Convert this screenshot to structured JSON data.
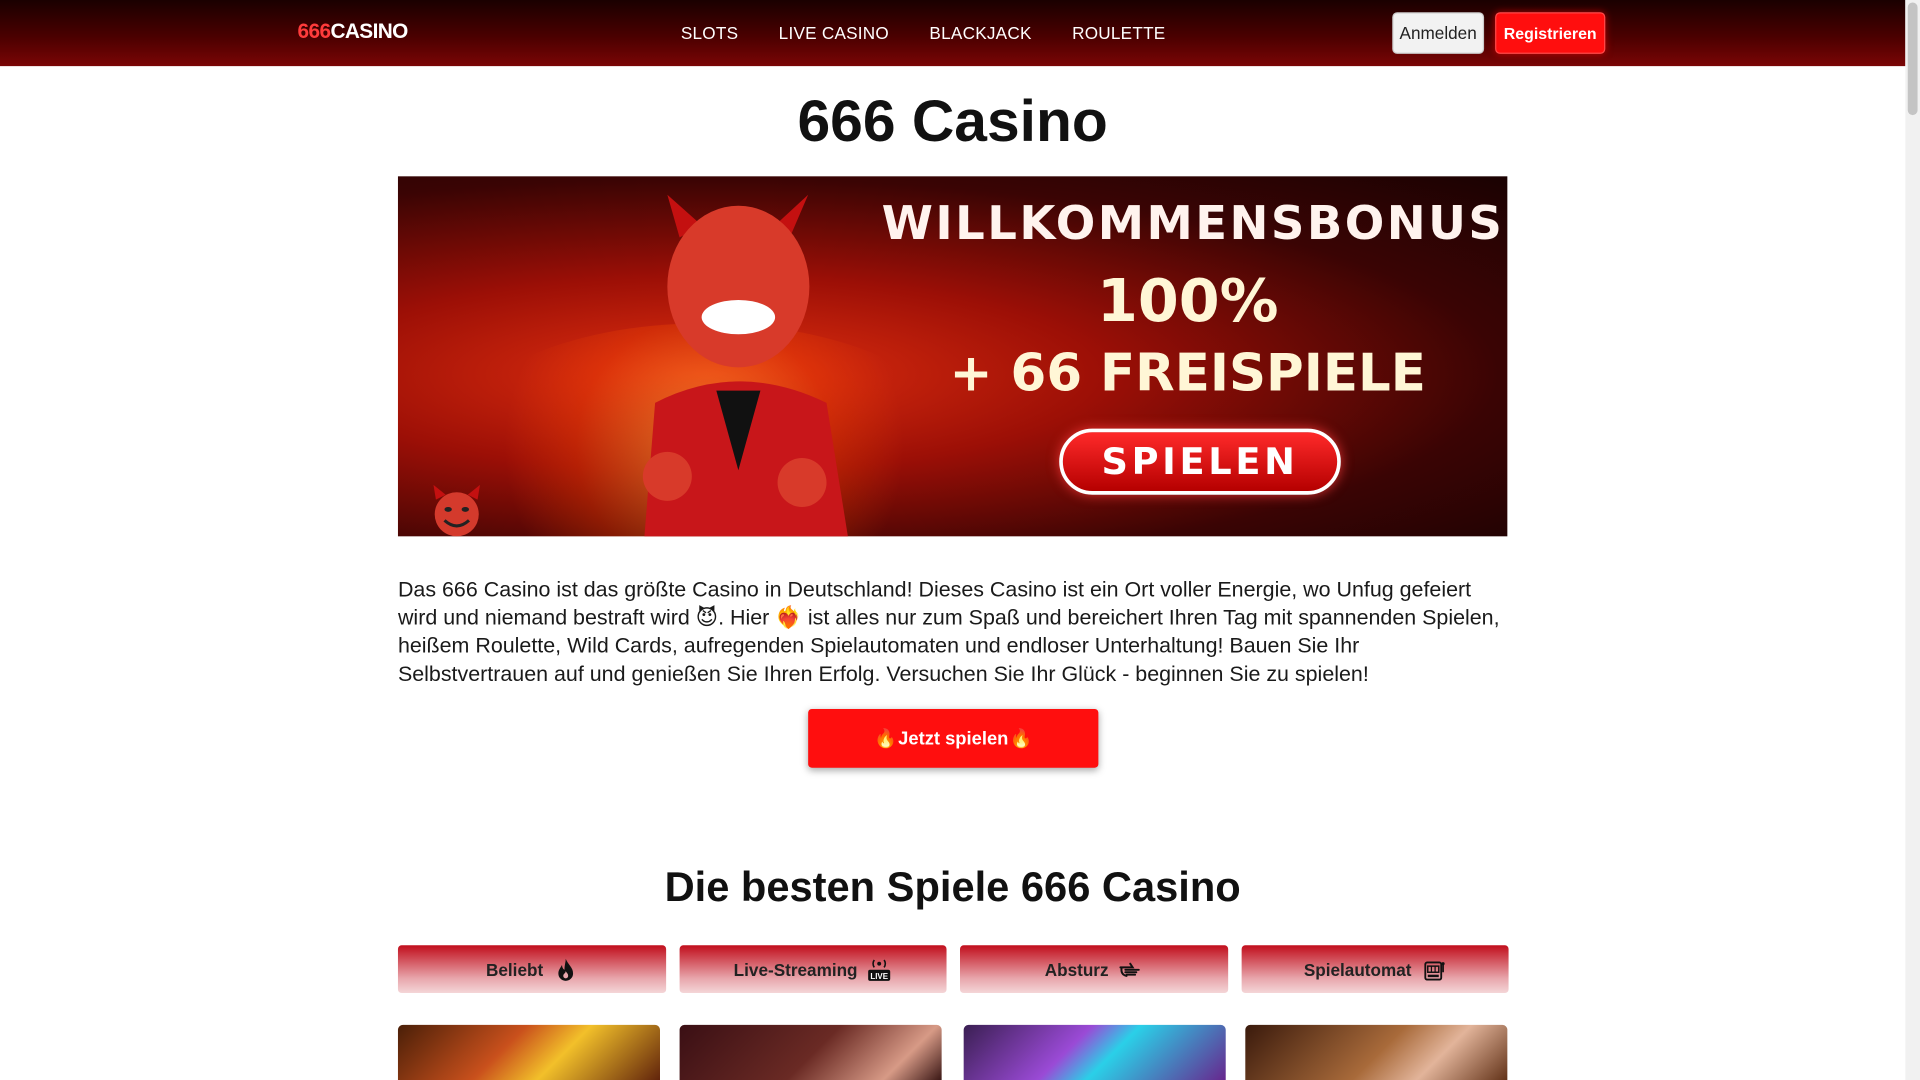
{
  "header": {
    "logo_num": "666",
    "logo_text": "CASINO",
    "nav": [
      "SLOTS",
      "LIVE CASINO",
      "BLACKJACK",
      "ROULETTE"
    ],
    "login_label": "Anmelden",
    "register_label": "Registrieren"
  },
  "page_title": "666 Casino",
  "banner": {
    "title": "WILLKOMMENSBONUS",
    "percent": "100%",
    "free_spins": "+ 66 FREISPIELE",
    "play_label": "SPIELEN"
  },
  "intro": {
    "part1": "Das 666 Casino ist das größte Casino in Deutschland! Dieses Casino ist ein Ort voller Energie, wo Unfug gefeiert wird und niemand bestraft wird ",
    "emoji1": "😈",
    "part2": ". Hier ",
    "emoji2": "❤️‍🔥",
    "part3": " ist alles nur zum Spaß und bereichert Ihren Tag mit spannenden Spielen, heißem Roulette, Wild Cards, aufregenden Spielautomaten und endloser Unterhaltung! Bauen Sie Ihr Selbstvertrauen auf und genießen Sie Ihren Erfolg. Versuchen Sie Ihr Glück - beginnen Sie zu spielen!"
  },
  "cta": {
    "fire_left": "🔥",
    "label": "Jetzt spielen",
    "fire_right": "🔥"
  },
  "games_section": {
    "title": "Die besten Spiele 666 Casino",
    "tabs": [
      {
        "label": "Beliebt",
        "icon": "flame-icon"
      },
      {
        "label": "Live-Streaming",
        "icon": "live-icon"
      },
      {
        "label": "Absturz",
        "icon": "pointing-hand-icon"
      },
      {
        "label": "Spielautomat",
        "icon": "slot-machine-icon"
      }
    ]
  },
  "colors": {
    "accent": "#ff0e0e",
    "header_dark": "#1a0000",
    "header_red": "#7a0505"
  }
}
